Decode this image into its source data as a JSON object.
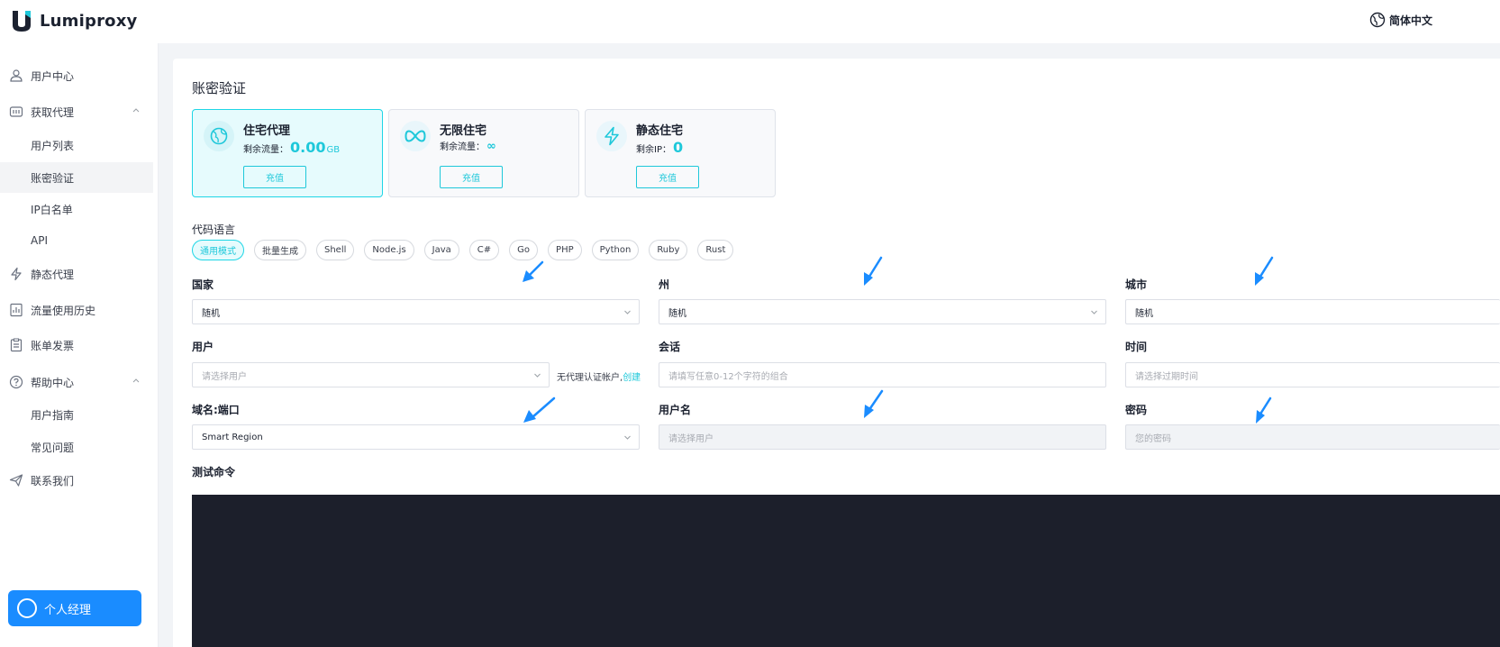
{
  "header": {
    "logo": "Lumiproxy",
    "language": "简体中文"
  },
  "sidebar": {
    "items": [
      {
        "label": "用户中心",
        "icon": "user-icon"
      },
      {
        "label": "获取代理",
        "icon": "proxy-icon",
        "expanded": true
      },
      {
        "label": "用户列表"
      },
      {
        "label": "账密验证",
        "active": true
      },
      {
        "label": "IP白名单"
      },
      {
        "label": "API"
      },
      {
        "label": "静态代理",
        "icon": "lightning-icon"
      },
      {
        "label": "流量使用历史",
        "icon": "chart-icon"
      },
      {
        "label": "账单发票",
        "icon": "invoice-icon"
      },
      {
        "label": "帮助中心",
        "icon": "help-icon",
        "expanded": true
      },
      {
        "label": "用户指南"
      },
      {
        "label": "常见问题"
      },
      {
        "label": "联系我们",
        "icon": "send-icon"
      }
    ],
    "manager_button": "个人经理"
  },
  "main": {
    "title": "账密验证",
    "cards": [
      {
        "title": "住宅代理",
        "sub_label": "剩余流量：",
        "value": "0.00",
        "unit": "GB",
        "button": "充值",
        "icon": "globe-icon"
      },
      {
        "title": "无限住宅",
        "sub_label": "剩余流量：",
        "value": "∞",
        "unit": "",
        "button": "充值",
        "icon": "infinity-icon"
      },
      {
        "title": "静态住宅",
        "sub_label": "剩余IP：",
        "value": "0",
        "unit": "",
        "button": "充值",
        "icon": "lightning-icon"
      }
    ],
    "code_language_title": "代码语言",
    "code_languages": [
      "通用模式",
      "批量生成",
      "Shell",
      "Node.js",
      "Java",
      "C#",
      "Go",
      "PHP",
      "Python",
      "Ruby",
      "Rust"
    ],
    "active_language": "通用模式",
    "fields": {
      "country": {
        "label": "国家",
        "value": "随机"
      },
      "state": {
        "label": "州",
        "value": "随机"
      },
      "city": {
        "label": "城市",
        "value": "随机"
      },
      "user": {
        "label": "用户",
        "placeholder": "请选择用户",
        "helper": "无代理认证帐户,",
        "helper_link": "创建"
      },
      "session": {
        "label": "会话",
        "placeholder": "请填写任意0-12个字符的组合"
      },
      "time": {
        "label": "时间",
        "placeholder": "请选择过期时间"
      },
      "domain_port": {
        "label": "域名:端口",
        "value": "Smart Region"
      },
      "username": {
        "label": "用户名",
        "placeholder": "请选择用户"
      },
      "password": {
        "label": "密码",
        "placeholder": "您的密码"
      }
    },
    "test_command_title": "测试命令"
  },
  "colors": {
    "accent": "#1ec8da",
    "annotation_arrow": "#1a8cff",
    "terminal_bg": "#1c1f2b"
  }
}
